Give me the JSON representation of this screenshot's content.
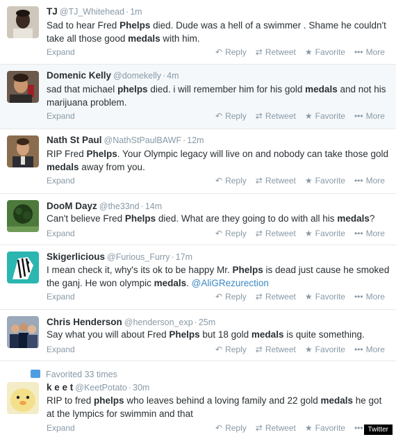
{
  "tweets": [
    {
      "name": "TJ",
      "handle": "@TJ_Whitehead",
      "time": "1m",
      "segments": [
        {
          "t": "Sad to hear Fred ",
          "b": false
        },
        {
          "t": "Phelps",
          "b": true
        },
        {
          "t": " died. Dude was a hell of a swimmer . Shame he couldn't take all those good ",
          "b": false
        },
        {
          "t": "medals",
          "b": true
        },
        {
          "t": " with him.",
          "b": false
        }
      ],
      "avatar": "man-dark-portrait"
    },
    {
      "name": "Domenic Kelly",
      "handle": "@domekelly",
      "time": "4m",
      "segments": [
        {
          "t": "sad that michael ",
          "b": false
        },
        {
          "t": "phelps",
          "b": true
        },
        {
          "t": " died. i will remember him for his gold ",
          "b": false
        },
        {
          "t": "medals",
          "b": true
        },
        {
          "t": " and not his marijuana problem.",
          "b": false
        }
      ],
      "avatar": "man-selfie"
    },
    {
      "name": "Nath St Paul",
      "handle": "@NathStPaulBAWF",
      "time": "12m",
      "segments": [
        {
          "t": "RIP Fred ",
          "b": false
        },
        {
          "t": "Phelps",
          "b": true
        },
        {
          "t": ". Your Olympic legacy will live on and nobody can take those gold ",
          "b": false
        },
        {
          "t": "medals",
          "b": true
        },
        {
          "t": " away from you.",
          "b": false
        }
      ],
      "avatar": "man-suit"
    },
    {
      "name": "DooM Dayz",
      "handle": "@the33nd",
      "time": "14m",
      "segments": [
        {
          "t": "Can't believe Fred ",
          "b": false
        },
        {
          "t": "Phelps",
          "b": true
        },
        {
          "t": " died. What are they going to do with all his ",
          "b": false
        },
        {
          "t": "medals",
          "b": true
        },
        {
          "t": "?",
          "b": false
        }
      ],
      "avatar": "green-plant"
    },
    {
      "name": "Skigerlicious",
      "handle": "@Furious_Furry",
      "time": "17m",
      "segments": [
        {
          "t": "I mean check it, why's its ok to be happy Mr. ",
          "b": false
        },
        {
          "t": "Phelps",
          "b": true
        },
        {
          "t": " is dead just cause he smoked the ganj. He won olympic ",
          "b": false
        },
        {
          "t": "medals",
          "b": true
        },
        {
          "t": ". ",
          "b": false
        },
        {
          "t": "@AliGRezurection",
          "b": false,
          "m": true
        }
      ],
      "avatar": "zebra-cartoon"
    },
    {
      "name": "Chris Henderson",
      "handle": "@henderson_exp",
      "time": "25m",
      "segments": [
        {
          "t": "Say what you will about Fred ",
          "b": false
        },
        {
          "t": "Phelps",
          "b": true
        },
        {
          "t": " but 18 gold ",
          "b": false
        },
        {
          "t": "medals",
          "b": true
        },
        {
          "t": " is quite something.",
          "b": false
        }
      ],
      "avatar": "group-photo"
    },
    {
      "name": "k e e t",
      "handle": "@KeetPotato",
      "time": "30m",
      "favorited": "Favorited 33 times",
      "segments": [
        {
          "t": "RIP to fred ",
          "b": false
        },
        {
          "t": "phelps",
          "b": true
        },
        {
          "t": " who leaves behind a loving family and 22 gold ",
          "b": false
        },
        {
          "t": "medals",
          "b": true
        },
        {
          "t": " he got at the lympics for swimmin and that",
          "b": false
        }
      ],
      "avatar": "yellow-duck"
    }
  ],
  "labels": {
    "expand": "Expand",
    "reply": "Reply",
    "retweet": "Retweet",
    "favorite": "Favorite",
    "more": "More"
  },
  "watermark": "Twitter",
  "colors": {
    "name": "#292f33",
    "meta": "#8899a6",
    "mention": "#3b88c3",
    "highlight_bg": "#f5f8fa"
  }
}
